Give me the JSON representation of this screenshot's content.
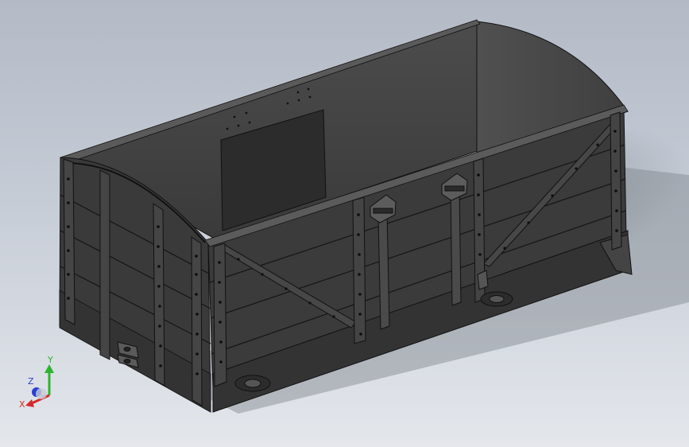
{
  "viewport": {
    "background_top": "#b3bac6",
    "background_bottom": "#e4e7ec"
  },
  "model": {
    "body_color": "#3a3a3a",
    "interior_color": "#4a4a4a",
    "edge_color": "#000000"
  },
  "triad": {
    "x_label": "X",
    "y_label": "Y",
    "z_label": "Z",
    "x_color": "#d42a2a",
    "y_color": "#2cb52c",
    "z_color": "#2a3fd4"
  }
}
